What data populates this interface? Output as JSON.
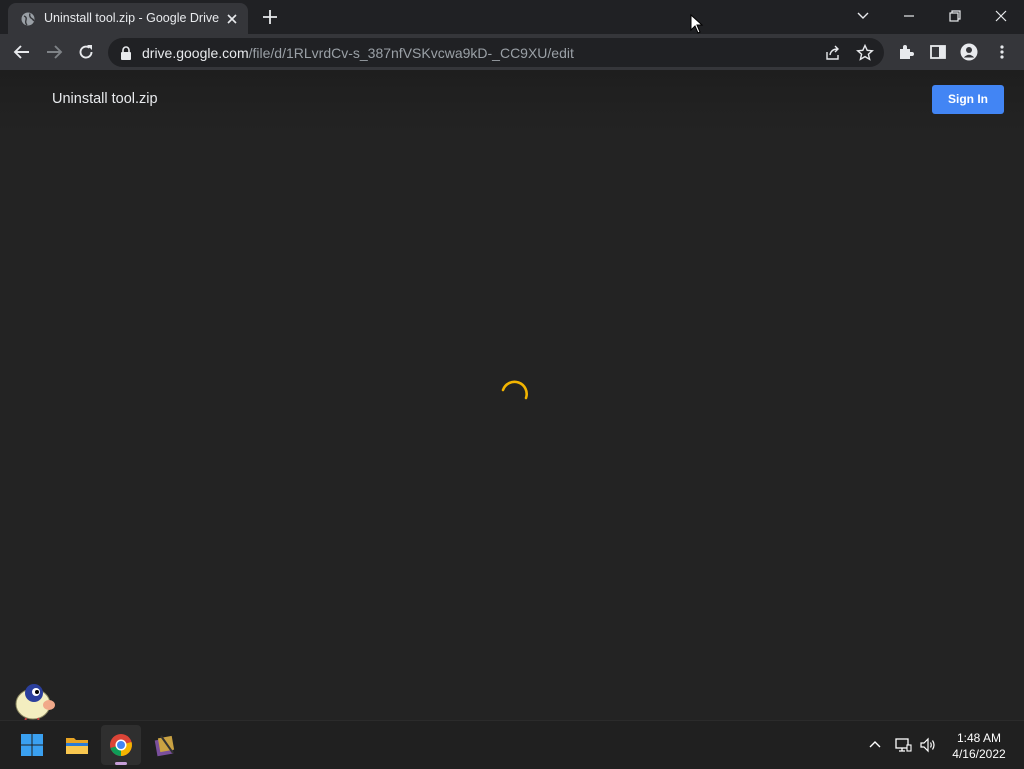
{
  "browser": {
    "tab": {
      "title": "Uninstall tool.zip - Google Drive"
    },
    "address": {
      "host": "drive.google.com",
      "path": "/file/d/1RLvrdCv-s_387nfVSKvcwa9kD-_CC9XU/edit"
    }
  },
  "page": {
    "file_title": "Uninstall tool.zip",
    "sign_in_label": "Sign In",
    "accent": "#4285f4",
    "spinner_color": "#f2b400"
  },
  "taskbar": {
    "apps": [
      "windows-start-icon",
      "file-explorer-icon",
      "chrome-icon",
      "winrar-icon"
    ],
    "clock": {
      "time": "1:48 AM",
      "date": "4/16/2022"
    }
  }
}
